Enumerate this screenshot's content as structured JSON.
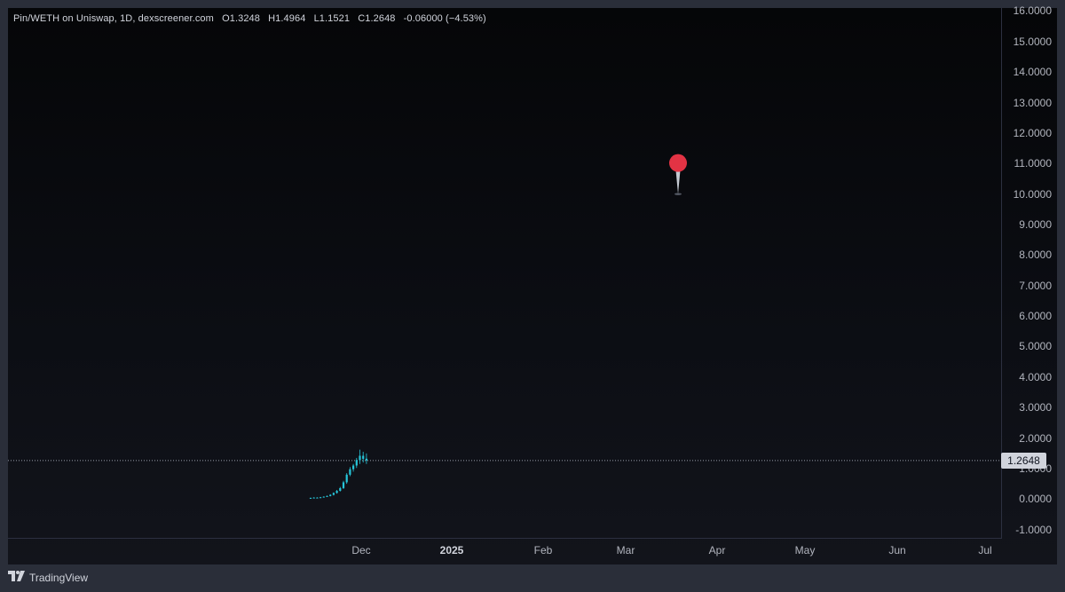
{
  "legend": {
    "symbol": "Pin/WETH on Uniswap, 1D, dexscreener.com",
    "open": "O1.3248",
    "high": "H1.4964",
    "low": "L1.1521",
    "close": "C1.2648",
    "change": "-0.06000 (−4.53%)"
  },
  "price_badge": "1.2648",
  "footer": {
    "brand": "TradingView",
    "icon": "tradingview-logo-icon"
  },
  "marker": {
    "icon": "map-pin-icon",
    "color": "#e23344",
    "value": 10.0
  },
  "colors": {
    "up": "#26c6da",
    "last_price_line": "#9aa0ab",
    "background": "#0c0e14"
  },
  "chart_data": {
    "type": "candlestick",
    "y_axis": {
      "range": [
        -1.3,
        16.1
      ],
      "ticks": [
        "16.0000",
        "15.0000",
        "14.0000",
        "13.0000",
        "12.0000",
        "11.0000",
        "10.0000",
        "9.0000",
        "8.0000",
        "7.0000",
        "6.0000",
        "5.0000",
        "4.0000",
        "3.0000",
        "2.0000",
        "1.0000",
        "0.0000",
        "-1.0000"
      ]
    },
    "x_axis": {
      "ticks": [
        {
          "label": "Dec",
          "bold": false
        },
        {
          "label": "2025",
          "bold": true
        },
        {
          "label": "Feb",
          "bold": false
        },
        {
          "label": "Mar",
          "bold": false
        },
        {
          "label": "Apr",
          "bold": false
        },
        {
          "label": "May",
          "bold": false
        },
        {
          "label": "Jun",
          "bold": false
        },
        {
          "label": "Jul",
          "bold": false
        }
      ]
    },
    "last_price": 1.2648,
    "candles": [
      [
        0.03,
        0.05,
        0.02,
        0.04
      ],
      [
        0.04,
        0.06,
        0.03,
        0.05
      ],
      [
        0.05,
        0.06,
        0.04,
        0.05
      ],
      [
        0.05,
        0.07,
        0.04,
        0.06
      ],
      [
        0.06,
        0.09,
        0.05,
        0.08
      ],
      [
        0.08,
        0.12,
        0.07,
        0.1
      ],
      [
        0.1,
        0.16,
        0.09,
        0.14
      ],
      [
        0.14,
        0.22,
        0.12,
        0.2
      ],
      [
        0.2,
        0.3,
        0.18,
        0.27
      ],
      [
        0.27,
        0.4,
        0.25,
        0.36
      ],
      [
        0.36,
        0.6,
        0.33,
        0.55
      ],
      [
        0.55,
        0.85,
        0.5,
        0.8
      ],
      [
        0.8,
        1.05,
        0.75,
        0.98
      ],
      [
        0.98,
        1.15,
        0.9,
        1.1
      ],
      [
        1.1,
        1.35,
        1.02,
        1.28
      ],
      [
        1.28,
        1.62,
        1.15,
        1.42
      ],
      [
        1.42,
        1.55,
        1.2,
        1.32
      ],
      [
        1.3248,
        1.4964,
        1.1521,
        1.2648
      ]
    ]
  }
}
